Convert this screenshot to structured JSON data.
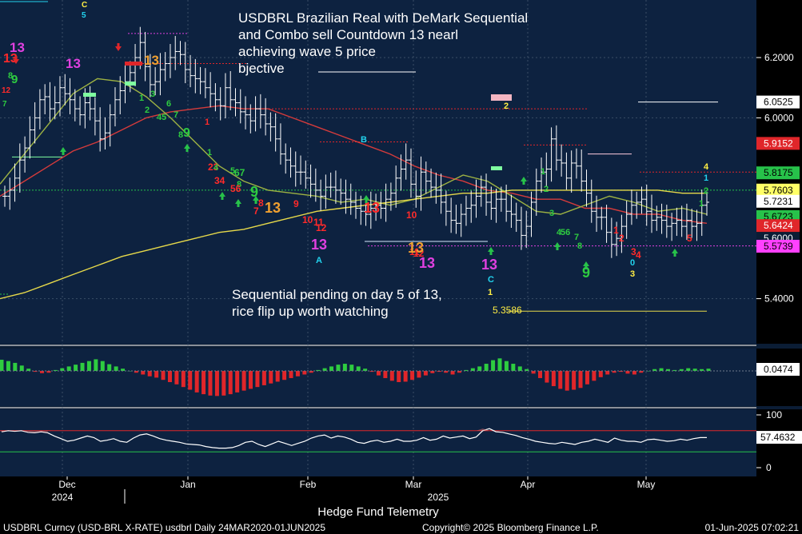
{
  "chart_data": [
    {
      "type": "line",
      "title": "USDBRL Brazilian Real with DeMark Sequential and Combo sell Countdown 13 nearly achieving wave 5 price objective",
      "annotation": "Sequential pending on day 5 of 13, price flip up worth watching",
      "objective_label": "5.3586",
      "ylim": [
        5.3,
        6.32
      ],
      "y_ticks": [
        "6.2000",
        "6.0000",
        "5.4000"
      ],
      "x_tick_labels": [
        "Dec",
        "Jan",
        "Feb",
        "Mar",
        "Apr",
        "May"
      ],
      "year_labels": [
        "2024",
        "2025"
      ],
      "price_tags": [
        {
          "label": "6.0525",
          "color": "#ffffff",
          "text": "#000000"
        },
        {
          "label": "5.9152",
          "color": "#e0262a",
          "text": "#ffffff"
        },
        {
          "label": "5.8175",
          "color": "#27c24a",
          "text": "#000000"
        },
        {
          "label": "5.7603",
          "color": "#ffff66",
          "text": "#000000"
        },
        {
          "label": "5.7231",
          "color": "#ffffff",
          "text": "#000000"
        },
        {
          "label": "5.6723",
          "color": "#27c24a",
          "text": "#000000"
        },
        {
          "label": "5.6424",
          "color": "#e0262a",
          "text": "#ffffff"
        },
        {
          "label": "5.6000",
          "color": "#0b1d35",
          "text": "#ffffff"
        },
        {
          "label": "5.5739",
          "color": "#ff40ff",
          "text": "#000000"
        }
      ],
      "series": [
        {
          "name": "USDBRL",
          "color": "#ffffff",
          "values": [
            5.74,
            5.76,
            5.8,
            5.86,
            5.9,
            5.96,
            6.0,
            6.06,
            6.07,
            6.03,
            6.05,
            6.1,
            6.08,
            6.06,
            6.03,
            6.01,
            6.05,
            6.03,
            5.99,
            5.93,
            5.95,
            6.01,
            6.06,
            6.09,
            6.12,
            6.15,
            6.2,
            6.25,
            6.17,
            6.11,
            6.12,
            6.16,
            6.18,
            6.2,
            6.22,
            6.21,
            6.16,
            6.14,
            6.13,
            6.12,
            6.1,
            6.08,
            6.06,
            6.04,
            6.1,
            6.06,
            6.05,
            6.02,
            6.01,
            5.99,
            6.03,
            6.01,
            5.98,
            5.97,
            5.93,
            5.88,
            5.86,
            5.84,
            5.82,
            5.82,
            5.8,
            5.78,
            5.76,
            5.74,
            5.77,
            5.77,
            5.76,
            5.75,
            5.73,
            5.72,
            5.7,
            5.69,
            5.68,
            5.7,
            5.71,
            5.7,
            5.73,
            5.75,
            5.8,
            5.83,
            5.86,
            5.78,
            5.74,
            5.82,
            5.79,
            5.77,
            5.76,
            5.72,
            5.69,
            5.66,
            5.65,
            5.68,
            5.7,
            5.71,
            5.74,
            5.77,
            5.72,
            5.7,
            5.73,
            5.73,
            5.69,
            5.68,
            5.66,
            5.61,
            5.64,
            5.72,
            5.79,
            5.82,
            5.83,
            5.93,
            5.86,
            5.85,
            5.8,
            5.85,
            5.84,
            5.79,
            5.75,
            5.69,
            5.67,
            5.67,
            5.62,
            5.58,
            5.6,
            5.64,
            5.68,
            5.71,
            5.72,
            5.73,
            5.69,
            5.66,
            5.67,
            5.66,
            5.64,
            5.65,
            5.66,
            5.64,
            5.66,
            5.64,
            5.65,
            5.71,
            5.72
          ]
        },
        {
          "name": "",
          "color": "#d53b3b",
          "values": [
            5.74,
            5.79,
            5.84,
            5.89,
            5.92,
            5.96,
            6.0,
            6.02,
            6.03,
            6.04,
            6.03,
            6.03,
            6.0,
            5.97,
            5.94,
            5.91,
            5.88,
            5.84,
            5.81,
            5.79,
            5.76,
            5.75,
            5.73,
            5.73,
            5.7,
            5.7,
            5.68,
            5.68,
            5.66,
            5.65
          ]
        },
        {
          "name": "",
          "color": "#9db243",
          "values": [
            5.78,
            5.88,
            5.98,
            6.08,
            6.13,
            6.12,
            6.07,
            6.0,
            5.92,
            5.84,
            5.79,
            5.76,
            5.75,
            5.74,
            5.72,
            5.73,
            5.71,
            5.73,
            5.77,
            5.81,
            5.79,
            5.74,
            5.69,
            5.68,
            5.71,
            5.74,
            5.72,
            5.69,
            5.7,
            5.68
          ]
        },
        {
          "name": "",
          "color": "#e6d94a",
          "values": [
            5.4,
            5.42,
            5.45,
            5.48,
            5.51,
            5.54,
            5.56,
            5.58,
            5.6,
            5.62,
            5.63,
            5.65,
            5.67,
            5.69,
            5.7,
            5.71,
            5.72,
            5.73,
            5.74,
            5.75,
            5.75,
            5.76,
            5.76,
            5.76,
            5.76,
            5.76,
            5.76,
            5.76,
            5.75,
            5.75
          ]
        }
      ]
    },
    {
      "type": "bar",
      "title": "",
      "last_value_label": "0.0474",
      "colors": {
        "positive": "#2ecc40",
        "negative": "#e0262a"
      },
      "values": [
        0.25,
        0.22,
        0.18,
        0.12,
        0.05,
        -0.02,
        -0.05,
        -0.04,
        0.02,
        0.06,
        0.1,
        0.14,
        0.18,
        0.22,
        0.26,
        0.22,
        0.15,
        0.1,
        0.05,
        0.0,
        -0.04,
        -0.08,
        -0.12,
        -0.15,
        -0.2,
        -0.25,
        -0.3,
        -0.36,
        -0.42,
        -0.48,
        -0.52,
        -0.55,
        -0.56,
        -0.55,
        -0.52,
        -0.48,
        -0.44,
        -0.4,
        -0.36,
        -0.32,
        -0.28,
        -0.24,
        -0.2,
        -0.16,
        -0.12,
        -0.08,
        -0.04,
        0.02,
        0.06,
        0.1,
        0.14,
        0.16,
        0.14,
        0.1,
        0.05,
        -0.02,
        -0.1,
        -0.16,
        -0.22,
        -0.25,
        -0.24,
        -0.2,
        -0.15,
        -0.1,
        -0.05,
        -0.02,
        -0.04,
        -0.08,
        -0.04,
        0.02,
        0.06,
        0.1,
        0.16,
        0.24,
        0.28,
        0.22,
        0.16,
        0.1,
        0.04,
        -0.06,
        -0.16,
        -0.26,
        -0.34,
        -0.4,
        -0.44,
        -0.42,
        -0.38,
        -0.3,
        -0.22,
        -0.14,
        -0.08,
        -0.04,
        -0.02,
        -0.06,
        -0.08,
        -0.04,
        0.0,
        0.04,
        0.06,
        0.04,
        0.02,
        0.04,
        0.06,
        0.05,
        0.04,
        0.05
      ]
    },
    {
      "type": "line",
      "title": "",
      "last_value_label": "57.4632",
      "ylim": [
        0,
        100
      ],
      "y_ticks": [
        "100",
        "0"
      ],
      "levels": [
        70,
        30
      ],
      "series": [
        {
          "name": "",
          "color": "#ffffff",
          "values": [
            68,
            70,
            69,
            70,
            67,
            66,
            68,
            66,
            60,
            55,
            50,
            52,
            56,
            60,
            57,
            50,
            52,
            55,
            50,
            48,
            56,
            62,
            64,
            60,
            55,
            52,
            50,
            48,
            45,
            44,
            43,
            40,
            38,
            37,
            37,
            38,
            42,
            48,
            50,
            44,
            40,
            45,
            50,
            46,
            42,
            46,
            50,
            56,
            60,
            62,
            56,
            60,
            58,
            54,
            48,
            46,
            50,
            52,
            48,
            50,
            54,
            50,
            50,
            52,
            57,
            52,
            54,
            60,
            56,
            58,
            60,
            55,
            58,
            70,
            74,
            68,
            67,
            64,
            61,
            57,
            54,
            50,
            48,
            46,
            45,
            48,
            46,
            44,
            48,
            50,
            54,
            51,
            48,
            56,
            52,
            50,
            50,
            48,
            53,
            54,
            52,
            50,
            51,
            54,
            52,
            55,
            57,
            57
          ]
        }
      ]
    }
  ],
  "demark_labels": [
    {
      "t": "13",
      "c": "#ff2a2a"
    },
    {
      "t": "13",
      "c": "#e040e0"
    },
    {
      "t": "9",
      "c": "#2ecc40"
    },
    {
      "t": "8",
      "c": "#2ecc40"
    },
    {
      "t": "12",
      "c": "#ff2a2a"
    },
    {
      "t": "7",
      "c": "#2ecc40"
    },
    {
      "t": "C",
      "c": "#ffee44"
    },
    {
      "t": "5",
      "c": "#22d3ee"
    },
    {
      "t": "13",
      "c": "#e040e0"
    },
    {
      "t": "13",
      "c": "#f0a030"
    },
    {
      "t": "1",
      "c": "#2ecc40"
    },
    {
      "t": "2",
      "c": "#2ecc40"
    },
    {
      "t": "3",
      "c": "#2ecc40"
    },
    {
      "t": "45",
      "c": "#2ecc40"
    },
    {
      "t": "6",
      "c": "#2ecc40"
    },
    {
      "t": "7",
      "c": "#2ecc40"
    },
    {
      "t": "8",
      "c": "#2ecc40"
    },
    {
      "t": "9",
      "c": "#2ecc40"
    },
    {
      "t": "1",
      "c": "#ff2a2a"
    },
    {
      "t": "1",
      "c": "#2ecc40"
    },
    {
      "t": "23",
      "c": "#ff2a2a"
    },
    {
      "t": "4",
      "c": "#2ecc40"
    },
    {
      "t": "34",
      "c": "#ff2a2a"
    },
    {
      "t": "5",
      "c": "#2ecc40"
    },
    {
      "t": "67",
      "c": "#2ecc40"
    },
    {
      "t": "8",
      "c": "#2ecc40"
    },
    {
      "t": "56",
      "c": "#ff2a2a"
    },
    {
      "t": "9",
      "c": "#2ecc40"
    },
    {
      "t": "8",
      "c": "#ff2a2a"
    },
    {
      "t": "7",
      "c": "#ff2a2a"
    },
    {
      "t": "13",
      "c": "#f0a030"
    },
    {
      "t": "9",
      "c": "#ff2a2a"
    },
    {
      "t": "10",
      "c": "#ff2a2a"
    },
    {
      "t": "11",
      "c": "#ff2a2a"
    },
    {
      "t": "12",
      "c": "#ff2a2a"
    },
    {
      "t": "13",
      "c": "#e040e0"
    },
    {
      "t": "A",
      "c": "#22d3ee"
    },
    {
      "t": "B",
      "c": "#22d3ee"
    },
    {
      "t": "13",
      "c": "#ff2a2a"
    },
    {
      "t": "10",
      "c": "#ff2a2a"
    },
    {
      "t": "11",
      "c": "#ff2a2a"
    },
    {
      "t": "12",
      "c": "#ff2a2a"
    },
    {
      "t": "13",
      "c": "#f0a030"
    },
    {
      "t": "13",
      "c": "#e040e0"
    },
    {
      "t": "13",
      "c": "#e040e0"
    },
    {
      "t": "C",
      "c": "#22d3ee"
    },
    {
      "t": "1",
      "c": "#ffee44"
    },
    {
      "t": "2",
      "c": "#ffee44"
    },
    {
      "t": "1",
      "c": "#2ecc40"
    },
    {
      "t": "2",
      "c": "#2ecc40"
    },
    {
      "t": "3",
      "c": "#2ecc40"
    },
    {
      "t": "4",
      "c": "#2ecc40"
    },
    {
      "t": "56",
      "c": "#2ecc40"
    },
    {
      "t": "7",
      "c": "#2ecc40"
    },
    {
      "t": "8",
      "c": "#2ecc40"
    },
    {
      "t": "9",
      "c": "#2ecc40"
    },
    {
      "t": "1",
      "c": "#ff2a2a"
    },
    {
      "t": "2",
      "c": "#ff2a2a"
    },
    {
      "t": "3",
      "c": "#ff2a2a"
    },
    {
      "t": "4",
      "c": "#ff2a2a"
    },
    {
      "t": "0",
      "c": "#22d3ee"
    },
    {
      "t": "3",
      "c": "#ffee44"
    },
    {
      "t": "5",
      "c": "#ff2a2a"
    },
    {
      "t": "4",
      "c": "#ffee44"
    },
    {
      "t": "1",
      "c": "#22d3ee"
    },
    {
      "t": "2",
      "c": "#2ecc40"
    },
    {
      "t": "1",
      "c": "#2ecc40"
    }
  ],
  "footer": {
    "center": "Hedge Fund Telemetry",
    "ticker": "USDBRL Curncy (USD-BRL X-RATE) usdbrl  Daily 24MAR2020-01JUN2025",
    "copyright": "Copyright© 2025 Bloomberg Finance L.P.",
    "timestamp": "01-Jun-2025 07:02:21"
  }
}
